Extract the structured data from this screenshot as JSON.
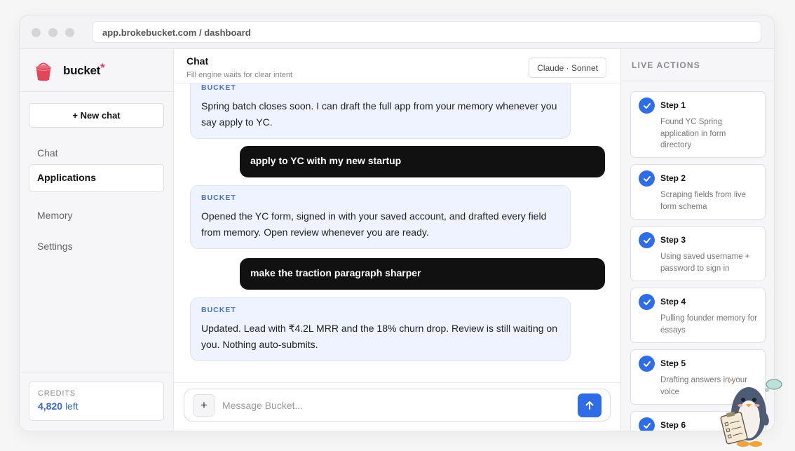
{
  "browser": {
    "url": "app.brokebucket.com / dashboard"
  },
  "sidebar": {
    "brand_name": "bucket",
    "brand_star": "*",
    "new_chat_label": "+ New chat",
    "nav": [
      {
        "label": "Chat",
        "active": false
      },
      {
        "label": "Applications",
        "active": true
      },
      {
        "label": "Memory",
        "active": false
      },
      {
        "label": "Settings",
        "active": false
      }
    ],
    "credits": {
      "label": "CREDITS",
      "value": "4,820",
      "suffix": "left"
    }
  },
  "chat": {
    "title": "Chat",
    "subtitle": "Fill engine waits for clear intent",
    "model": "Claude · Sonnet",
    "messages": [
      {
        "role": "bot",
        "label": "BUCKET",
        "text": "Spring batch closes soon. I can draft the full app from your memory whenever you say apply to YC."
      },
      {
        "role": "user",
        "text": "apply to YC with my new startup"
      },
      {
        "role": "bot",
        "label": "BUCKET",
        "text": "Opened the YC form, signed in with your saved account, and drafted every field from memory. Open review whenever you are ready."
      },
      {
        "role": "user",
        "text": "make the traction paragraph sharper"
      },
      {
        "role": "bot",
        "label": "BUCKET",
        "text": "Updated. Lead with ₹4.2L MRR and the 18% churn drop. Review is still waiting on you. Nothing auto-submits."
      }
    ],
    "composer": {
      "plus": "+",
      "placeholder": "Message Bucket..."
    }
  },
  "live_actions": {
    "title": "LIVE ACTIONS",
    "steps": [
      {
        "title": "Step 1",
        "desc": "Found YC Spring application in form directory"
      },
      {
        "title": "Step 2",
        "desc": "Scraping fields from live form schema"
      },
      {
        "title": "Step 3",
        "desc": "Using saved username + password to sign in"
      },
      {
        "title": "Step 4",
        "desc": "Pulling founder memory for essays"
      },
      {
        "title": "Step 5",
        "desc": "Drafting answers in your voice"
      },
      {
        "title": "Step 6",
        "desc": ""
      }
    ]
  },
  "colors": {
    "accent": "#2f6de6",
    "brand_star": "#e8336d",
    "bot_bubble": "#eef3ff",
    "user_bubble": "#111111"
  }
}
